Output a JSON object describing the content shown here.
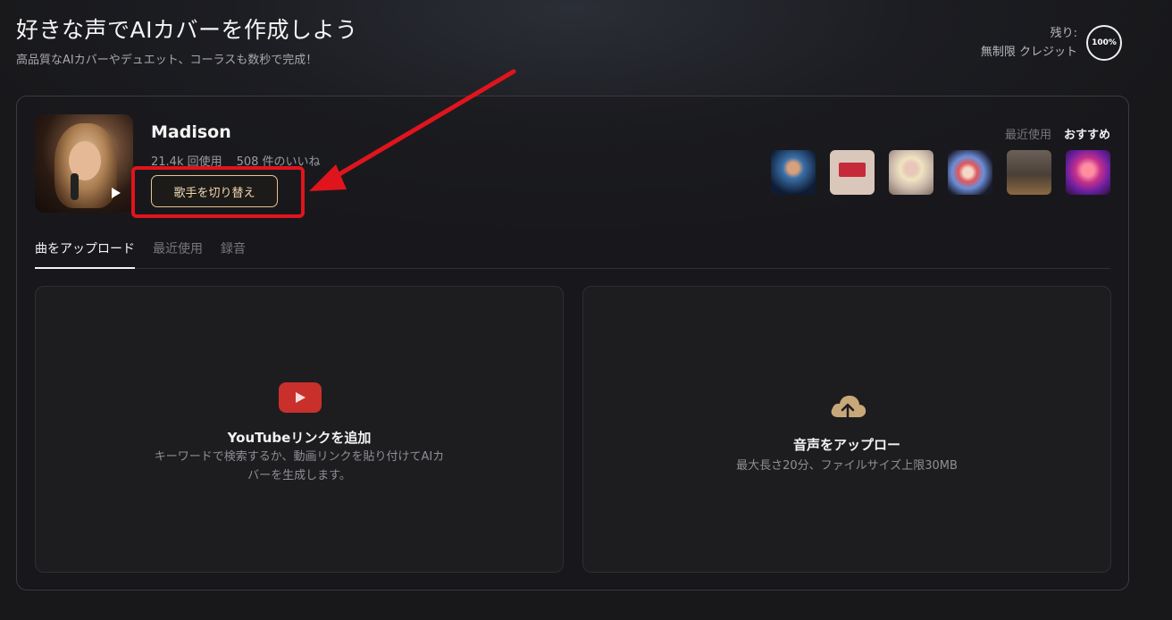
{
  "header": {
    "title": "好きな声でAIカバーを作成しよう",
    "subtitle": "高品質なAIカバーやデュエット、コーラスも数秒で完成！",
    "remaining_label": "残り:",
    "credit_label": "無制限 クレジット",
    "credit_percent": "100%"
  },
  "singer": {
    "name": "Madison",
    "uses": "21.4k 回使用",
    "likes": "508 件のいいね",
    "switch_label": "歌手を切り替え",
    "tabs": [
      "最近使用",
      "おすすめ"
    ]
  },
  "upload": {
    "tabs": [
      "曲をアップロード",
      "最近使用",
      "録音"
    ],
    "youtube": {
      "title": "YouTubeリンクを追加",
      "desc": "キーワードで検索するか、動画リンクを貼り付けてAIカバーを生成します。"
    },
    "audio": {
      "title": "音声をアップロー",
      "desc": "最大長さ20分、ファイルサイズ上限30MB"
    }
  },
  "colors": {
    "highlight": "#e0141c",
    "switch_border": "#e8c48e",
    "youtube_red": "#c9302c",
    "cloud_gold": "#c8a878"
  }
}
